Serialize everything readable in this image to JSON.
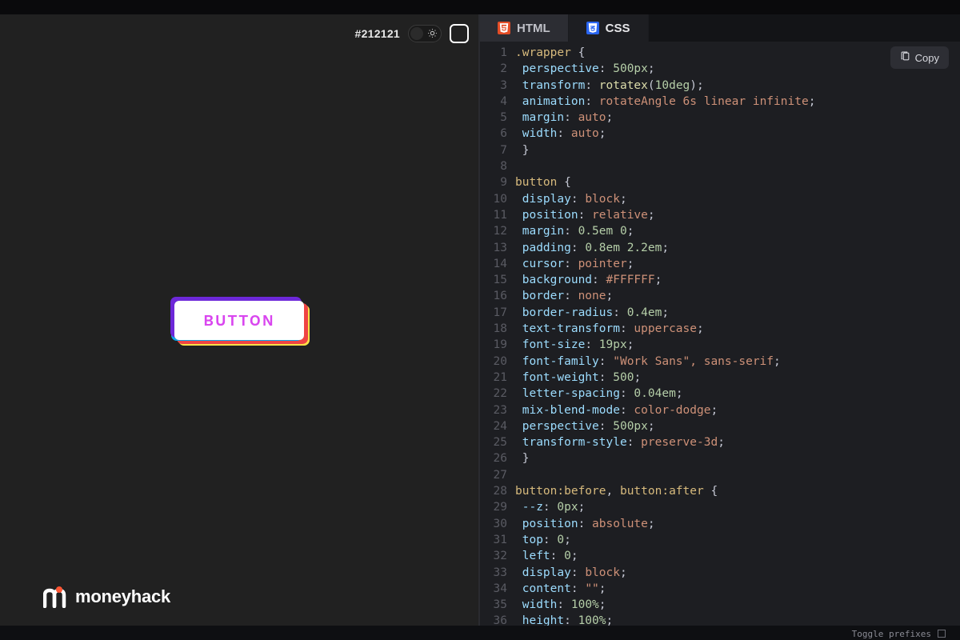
{
  "preview": {
    "hex": "#212121",
    "button_label": "BUTTON"
  },
  "brand": {
    "name": "moneyhack"
  },
  "tabs": [
    {
      "label": "HTML",
      "active": false
    },
    {
      "label": "CSS",
      "active": true
    }
  ],
  "copy_label": "Copy",
  "footer": {
    "toggle_prefixes": "Toggle prefixes"
  },
  "code": {
    "lines": [
      [
        [
          "sel",
          ".wrapper"
        ],
        [
          "punc",
          " {"
        ]
      ],
      [
        [
          "prop",
          " perspective"
        ],
        [
          "punc",
          ": "
        ],
        [
          "num",
          "500px"
        ],
        [
          "punc",
          ";"
        ]
      ],
      [
        [
          "prop",
          " transform"
        ],
        [
          "punc",
          ": "
        ],
        [
          "func",
          "rotatex"
        ],
        [
          "punc",
          "("
        ],
        [
          "num",
          "10deg"
        ],
        [
          "punc",
          ");"
        ]
      ],
      [
        [
          "prop",
          " animation"
        ],
        [
          "punc",
          ": "
        ],
        [
          "val",
          "rotateAngle 6s linear infinite"
        ],
        [
          "punc",
          ";"
        ]
      ],
      [
        [
          "prop",
          " margin"
        ],
        [
          "punc",
          ": "
        ],
        [
          "val",
          "auto"
        ],
        [
          "punc",
          ";"
        ]
      ],
      [
        [
          "prop",
          " width"
        ],
        [
          "punc",
          ": "
        ],
        [
          "val",
          "auto"
        ],
        [
          "punc",
          ";"
        ]
      ],
      [
        [
          "punc",
          " }"
        ]
      ],
      [],
      [
        [
          "sel",
          "button"
        ],
        [
          "punc",
          " {"
        ]
      ],
      [
        [
          "prop",
          " display"
        ],
        [
          "punc",
          ": "
        ],
        [
          "val",
          "block"
        ],
        [
          "punc",
          ";"
        ]
      ],
      [
        [
          "prop",
          " position"
        ],
        [
          "punc",
          ": "
        ],
        [
          "val",
          "relative"
        ],
        [
          "punc",
          ";"
        ]
      ],
      [
        [
          "prop",
          " margin"
        ],
        [
          "punc",
          ": "
        ],
        [
          "num",
          "0.5em 0"
        ],
        [
          "punc",
          ";"
        ]
      ],
      [
        [
          "prop",
          " padding"
        ],
        [
          "punc",
          ": "
        ],
        [
          "num",
          "0.8em 2.2em"
        ],
        [
          "punc",
          ";"
        ]
      ],
      [
        [
          "prop",
          " cursor"
        ],
        [
          "punc",
          ": "
        ],
        [
          "val",
          "pointer"
        ],
        [
          "punc",
          ";"
        ]
      ],
      [
        [
          "prop",
          " background"
        ],
        [
          "punc",
          ": "
        ],
        [
          "val",
          "#FFFFFF"
        ],
        [
          "punc",
          ";"
        ]
      ],
      [
        [
          "prop",
          " border"
        ],
        [
          "punc",
          ": "
        ],
        [
          "val",
          "none"
        ],
        [
          "punc",
          ";"
        ]
      ],
      [
        [
          "prop",
          " border-radius"
        ],
        [
          "punc",
          ": "
        ],
        [
          "num",
          "0.4em"
        ],
        [
          "punc",
          ";"
        ]
      ],
      [
        [
          "prop",
          " text-transform"
        ],
        [
          "punc",
          ": "
        ],
        [
          "val",
          "uppercase"
        ],
        [
          "punc",
          ";"
        ]
      ],
      [
        [
          "prop",
          " font-size"
        ],
        [
          "punc",
          ": "
        ],
        [
          "num",
          "19px"
        ],
        [
          "punc",
          ";"
        ]
      ],
      [
        [
          "prop",
          " font-family"
        ],
        [
          "punc",
          ": "
        ],
        [
          "val",
          "\"Work Sans\", sans-serif"
        ],
        [
          "punc",
          ";"
        ]
      ],
      [
        [
          "prop",
          " font-weight"
        ],
        [
          "punc",
          ": "
        ],
        [
          "num",
          "500"
        ],
        [
          "punc",
          ";"
        ]
      ],
      [
        [
          "prop",
          " letter-spacing"
        ],
        [
          "punc",
          ": "
        ],
        [
          "num",
          "0.04em"
        ],
        [
          "punc",
          ";"
        ]
      ],
      [
        [
          "prop",
          " mix-blend-mode"
        ],
        [
          "punc",
          ": "
        ],
        [
          "val",
          "color-dodge"
        ],
        [
          "punc",
          ";"
        ]
      ],
      [
        [
          "prop",
          " perspective"
        ],
        [
          "punc",
          ": "
        ],
        [
          "num",
          "500px"
        ],
        [
          "punc",
          ";"
        ]
      ],
      [
        [
          "prop",
          " transform-style"
        ],
        [
          "punc",
          ": "
        ],
        [
          "val",
          "preserve-3d"
        ],
        [
          "punc",
          ";"
        ]
      ],
      [
        [
          "punc",
          " }"
        ]
      ],
      [],
      [
        [
          "sel",
          "button:before"
        ],
        [
          "punc",
          ", "
        ],
        [
          "sel",
          "button:after"
        ],
        [
          "punc",
          " {"
        ]
      ],
      [
        [
          "prop",
          " --z"
        ],
        [
          "punc",
          ": "
        ],
        [
          "num",
          "0px"
        ],
        [
          "punc",
          ";"
        ]
      ],
      [
        [
          "prop",
          " position"
        ],
        [
          "punc",
          ": "
        ],
        [
          "val",
          "absolute"
        ],
        [
          "punc",
          ";"
        ]
      ],
      [
        [
          "prop",
          " top"
        ],
        [
          "punc",
          ": "
        ],
        [
          "num",
          "0"
        ],
        [
          "punc",
          ";"
        ]
      ],
      [
        [
          "prop",
          " left"
        ],
        [
          "punc",
          ": "
        ],
        [
          "num",
          "0"
        ],
        [
          "punc",
          ";"
        ]
      ],
      [
        [
          "prop",
          " display"
        ],
        [
          "punc",
          ": "
        ],
        [
          "val",
          "block"
        ],
        [
          "punc",
          ";"
        ]
      ],
      [
        [
          "prop",
          " content"
        ],
        [
          "punc",
          ": "
        ],
        [
          "val",
          "\"\""
        ],
        [
          "punc",
          ";"
        ]
      ],
      [
        [
          "prop",
          " width"
        ],
        [
          "punc",
          ": "
        ],
        [
          "num",
          "100%"
        ],
        [
          "punc",
          ";"
        ]
      ],
      [
        [
          "prop",
          " height"
        ],
        [
          "punc",
          ": "
        ],
        [
          "num",
          "100%"
        ],
        [
          "punc",
          ";"
        ]
      ]
    ]
  }
}
